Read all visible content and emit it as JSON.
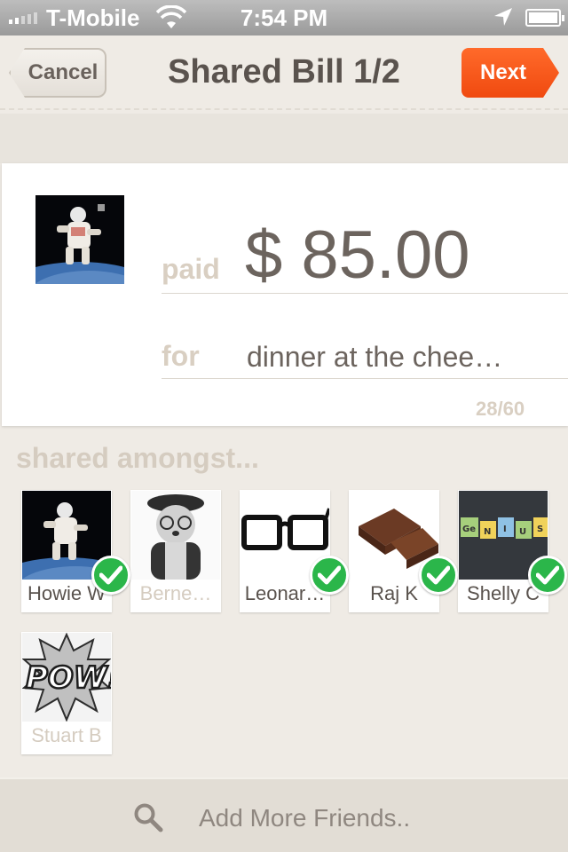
{
  "status_bar": {
    "carrier": "T-Mobile",
    "time": "7:54 PM",
    "icons": [
      "signal-icon",
      "wifi-icon",
      "location-icon",
      "battery-icon"
    ]
  },
  "nav": {
    "cancel_label": "Cancel",
    "title": "Shared Bill 1/2",
    "next_label": "Next",
    "accent_color": "#f05a1e"
  },
  "bill": {
    "paid_label": "paid",
    "amount": "$ 85.00",
    "for_label": "for",
    "description": "dinner at the chee…",
    "char_count": "28/60"
  },
  "shared": {
    "label": "shared amongst...",
    "friends": [
      {
        "name": "Howie W",
        "selected": true
      },
      {
        "name": "Berne…",
        "selected": false
      },
      {
        "name": "Leonar…",
        "selected": true
      },
      {
        "name": "Raj K",
        "selected": true
      },
      {
        "name": "Shelly C",
        "selected": true
      },
      {
        "name": "Stuart B",
        "selected": false
      }
    ]
  },
  "bottom": {
    "add_more_label": "Add More Friends.."
  }
}
